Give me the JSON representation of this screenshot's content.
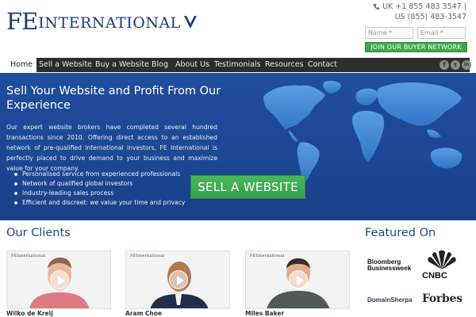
{
  "header": {
    "logo_fe": "FE",
    "logo_intl": "INTERNATIONAL",
    "phone_uk": "UK +1 855 483 3547 |",
    "phone_us": "US (855) 483-3547",
    "name_placeholder": "Name *",
    "email_placeholder": "Email *",
    "join_label": "JOIN OUR BUYER NETWORK"
  },
  "nav": {
    "items": [
      {
        "label": "Home",
        "active": true
      },
      {
        "label": "Sell a Website"
      },
      {
        "label": "Buy a Website"
      },
      {
        "label": "Blog"
      },
      {
        "label": "About Us"
      },
      {
        "label": "Testimonials"
      },
      {
        "label": "Resources"
      },
      {
        "label": "Contact"
      }
    ],
    "social": [
      "f",
      "t",
      "in"
    ]
  },
  "hero": {
    "title": "Sell Your Website and Profit From Our Experience",
    "description": "Our expert website brokers have completed several hundred transactions since 2010. Offering direct access to an established network of pre-qualified international investors, FE International is perfectly placed to drive demand to your business and maximize value for your company.",
    "bullets": [
      "Personalised service from experienced professionals",
      "Network of qualified global investors",
      "Industry-leading sales process",
      "Efficient and discreet: we value your time and privacy"
    ],
    "cta_label": "SELL A WEBSITE"
  },
  "clients": {
    "title": "Our Clients",
    "video_logo": "FEInternational",
    "items": [
      {
        "name": "Wilko de Kreij"
      },
      {
        "name": "Aram Choe"
      },
      {
        "name": "Miles Baker"
      }
    ]
  },
  "featured": {
    "title": "Featured On",
    "bloomberg_line1": "Bloomberg",
    "bloomberg_line2": "Businessweek",
    "cnbc": "CNBC",
    "domainsherpa": "DomainSherpa",
    "forbes": "Forbes"
  },
  "colors": {
    "brand_blue": "#1c3a7a",
    "hero_blue": "#1f4e9c",
    "nav_dark": "#2d2d2d",
    "cta_green": "#3ea84d"
  }
}
